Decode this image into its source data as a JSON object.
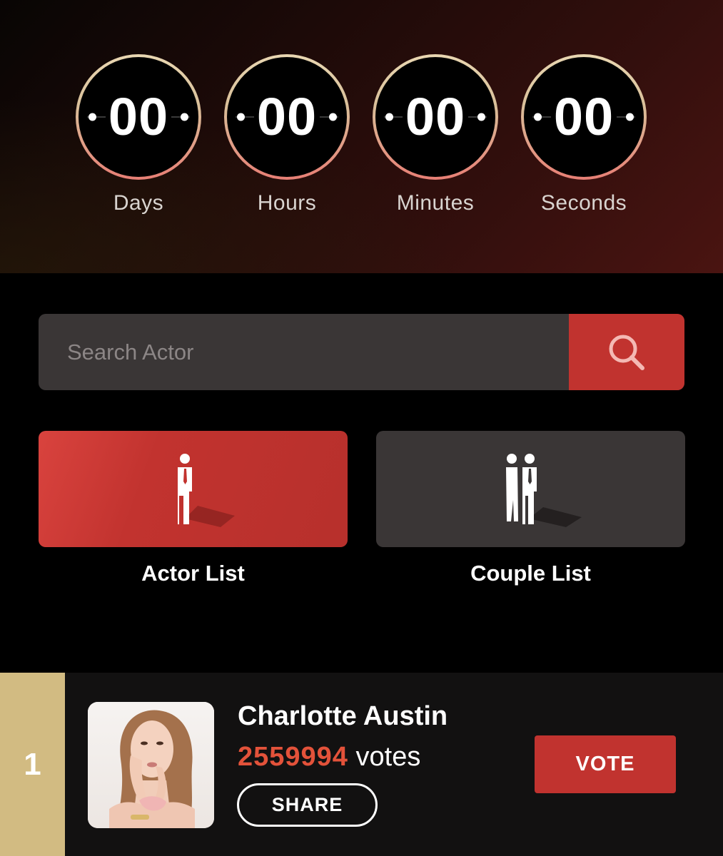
{
  "countdown": {
    "units": [
      {
        "value": "00",
        "label": "Days"
      },
      {
        "value": "00",
        "label": "Hours"
      },
      {
        "value": "00",
        "label": "Minutes"
      },
      {
        "value": "00",
        "label": "Seconds"
      }
    ]
  },
  "search": {
    "placeholder": "Search Actor",
    "value": "",
    "button_icon": "search-icon"
  },
  "lists": {
    "actor": {
      "label": "Actor List",
      "icon": "single-person-icon"
    },
    "couple": {
      "label": "Couple List",
      "icon": "couple-icon"
    }
  },
  "ranking": {
    "rank": "1",
    "name": "Charlotte Austin",
    "votes": "2559994",
    "votes_suffix": "votes",
    "share_label": "SHARE",
    "vote_label": "VOTE"
  },
  "colors": {
    "accent_red": "#c1332f",
    "rank_gold": "#d2bb82",
    "vote_count": "#e3523a",
    "panel_gray": "#3a3636"
  }
}
